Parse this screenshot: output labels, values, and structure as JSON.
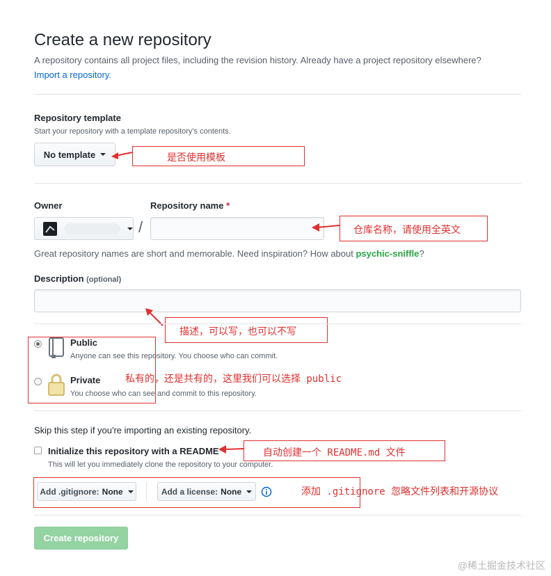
{
  "header": {
    "title": "Create a new repository",
    "subtitle": "A repository contains all project files, including the revision history. Already have a project repository elsewhere?",
    "import_link": "Import a repository."
  },
  "template": {
    "label": "Repository template",
    "note": "Start your repository with a template repository's contents.",
    "button_label": "No template"
  },
  "owner": {
    "label": "Owner",
    "separator": "/"
  },
  "repo_name": {
    "label": "Repository name",
    "required_mark": "*",
    "value": "",
    "hint_prefix": "Great repository names are short and memorable. Need inspiration? How about ",
    "suggestion": "psychic-sniffle",
    "hint_suffix": "?"
  },
  "description": {
    "label": "Description",
    "optional": "(optional)",
    "value": ""
  },
  "visibility": {
    "selected": "public",
    "options": [
      {
        "title": "Public",
        "note": "Anyone can see this repository. You choose who can commit."
      },
      {
        "title": "Private",
        "note": "You choose who can see and commit to this repository."
      }
    ]
  },
  "init": {
    "skip_note": "Skip this step if you're importing an existing repository.",
    "readme_label": "Initialize this repository with a README",
    "readme_note": "This will let you immediately clone the repository to your computer.",
    "readme_checked": false,
    "gitignore_button": "Add .gitignore:",
    "gitignore_value": "None",
    "license_button": "Add a license:",
    "license_value": "None"
  },
  "submit": {
    "label": "Create repository"
  },
  "annotations": {
    "template": "是否使用模板",
    "repo_name": "仓库名称，请使用全英文",
    "description": "描述，可以写，也可以不写",
    "visibility": "私有的，还是共有的，这里我们可以选择 public",
    "readme": "自动创建一个 README.md 文件",
    "gitignore": "添加 .gitignore 忽略文件列表和开源协议"
  },
  "watermark": "@稀土掘金技术社区",
  "colors": {
    "annotation_red": "#e0302f",
    "link_blue": "#0366d6",
    "suggestion_green": "#28a745",
    "create_button_bg": "#94d3a2"
  }
}
